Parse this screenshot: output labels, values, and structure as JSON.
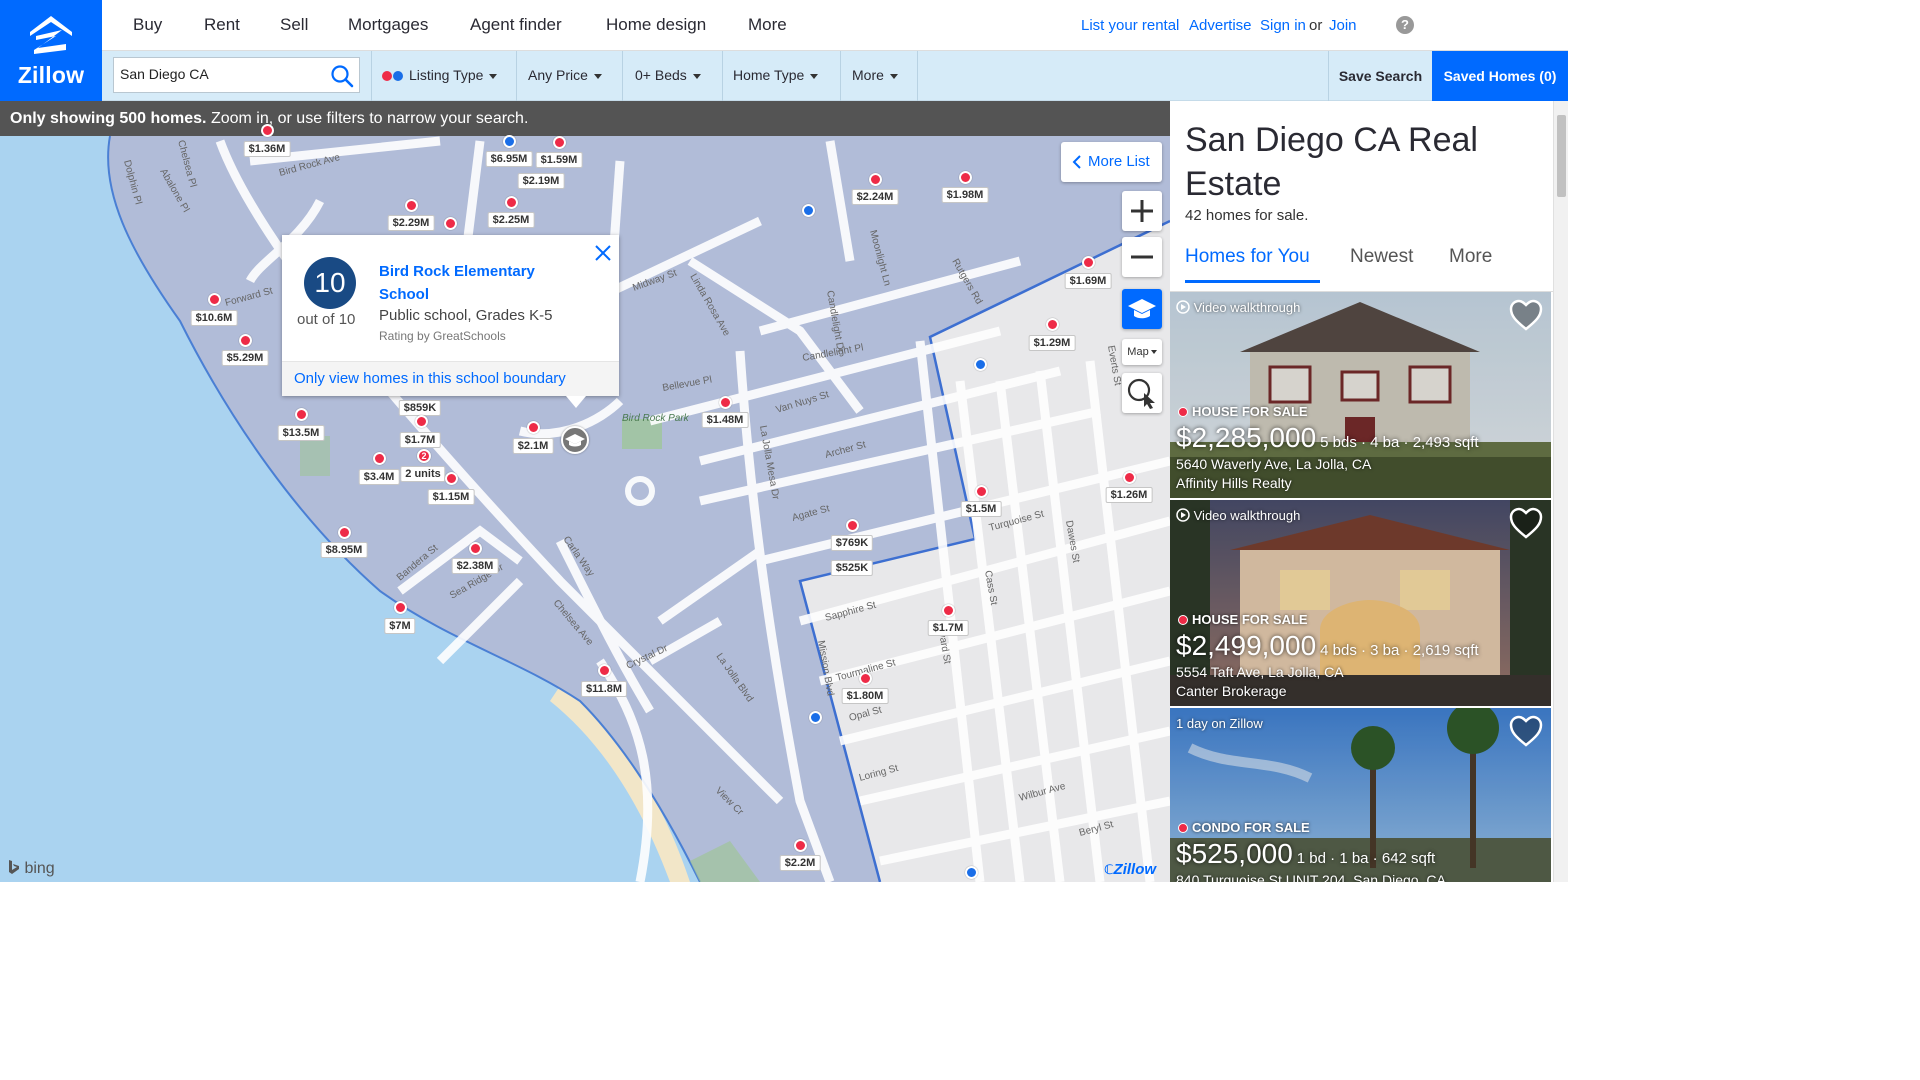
{
  "brand": {
    "name": "Zillow",
    "color": "#006aff"
  },
  "nav": {
    "items": [
      "Buy",
      "Rent",
      "Sell",
      "Mortgages",
      "Agent finder",
      "Home design",
      "More"
    ],
    "right": {
      "list_rental": "List your rental",
      "advertise": "Advertise",
      "sign_in": "Sign in",
      "or": "or",
      "join": "Join",
      "help": "?"
    }
  },
  "filters": {
    "search_value": "San Diego CA",
    "listing_type": "Listing Type",
    "price": "Any Price",
    "beds": "0+ Beds",
    "home_type": "Home Type",
    "more": "More",
    "save_search": "Save Search",
    "saved_homes": "Saved Homes (0)"
  },
  "map": {
    "notice_bold": "Only showing 500 homes.",
    "notice_rest": " Zoom in, or use filters to narrow your search.",
    "more_list": "More List",
    "map_mode": "Map",
    "attribution": "bing",
    "watermark": "Zillow",
    "boundary_label": "Bird Rock Park",
    "school_popup": {
      "rating": "10",
      "out_of": "out of 10",
      "name": "Bird Rock Elementary School",
      "type": "Public school, Grades K-5",
      "source": "Rating by GreatSchools",
      "boundary_link": "Only view homes in this school boundary"
    },
    "street_labels": [
      "Bird Rock Ave",
      "Chelsea Pl",
      "Dolphin Pl",
      "Abalone Pl",
      "Forward St",
      "Midway St",
      "Linda Rosa Ave",
      "Candlelight Dr",
      "Candlelight Pl",
      "Moonlight Ln",
      "Rutgers Rd",
      "Van Nuys St",
      "Bellevue Pl",
      "Archer St",
      "Agate St",
      "La Jolla Mesa Dr",
      "Carla Way",
      "Bandera St",
      "Sea Ridge Dr",
      "Chelsea Ave",
      "Crystal Dr",
      "La Jolla Blvd",
      "Mission Blvd",
      "Turquoise St",
      "Sapphire St",
      "Tourmaline St",
      "Opal St",
      "Loring St",
      "Wilbur Ave",
      "Beryl St",
      "Cass St",
      "Dawes St",
      "Everts St",
      "Bayard St",
      "View Cr"
    ],
    "pins": [
      {
        "label": "$1.36M",
        "color": "red"
      },
      {
        "label": "$6.95M",
        "color": "blue"
      },
      {
        "label": "$1.59M",
        "color": "red"
      },
      {
        "label": "$2.19M",
        "color": "red"
      },
      {
        "label": "$2.29M",
        "color": "red"
      },
      {
        "label": "$2.25M",
        "color": "red"
      },
      {
        "label": "$2.24M",
        "color": "red"
      },
      {
        "label": "$1.98M",
        "color": "red"
      },
      {
        "label": "$1.69M",
        "color": "red"
      },
      {
        "label": "$10.6M",
        "color": "red"
      },
      {
        "label": "$5.29M",
        "color": "red"
      },
      {
        "label": "$1.29M",
        "color": "red"
      },
      {
        "label": "$859K",
        "color": "red"
      },
      {
        "label": "$1.7M",
        "color": "red"
      },
      {
        "label": "$1.48M",
        "color": "red"
      },
      {
        "label": "$13.5M",
        "color": "red"
      },
      {
        "label": "$2.1M",
        "color": "red"
      },
      {
        "label": "$3.4M",
        "color": "red"
      },
      {
        "label": "2 units",
        "color": "red"
      },
      {
        "label": "$1.15M",
        "color": "red"
      },
      {
        "label": "$1.5M",
        "color": "red"
      },
      {
        "label": "$1.26M",
        "color": "red"
      },
      {
        "label": "$8.95M",
        "color": "red"
      },
      {
        "label": "$2.38M",
        "color": "red"
      },
      {
        "label": "$769K",
        "color": "red"
      },
      {
        "label": "$525K",
        "color": "red"
      },
      {
        "label": "$7M",
        "color": "red"
      },
      {
        "label": "$1.7M",
        "color": "red"
      },
      {
        "label": "$11.8M",
        "color": "red"
      },
      {
        "label": "$1.80M",
        "color": "red"
      },
      {
        "label": "$2.2M",
        "color": "red"
      }
    ],
    "cluster_count": "2"
  },
  "sidebar": {
    "title": "San Diego CA Real Estate",
    "count": "42 homes for sale.",
    "tabs": [
      "Homes for You",
      "Newest",
      "More"
    ],
    "listings": [
      {
        "top": "Video walkthrough",
        "type": "HOUSE FOR SALE",
        "price": "$2,285,000",
        "facts": "5 bds · 4 ba · 2,493 sqft",
        "address": "5640 Waverly Ave, La Jolla, CA",
        "broker": "Affinity Hills Realty"
      },
      {
        "top": "Video walkthrough",
        "type": "HOUSE FOR SALE",
        "price": "$2,499,000",
        "facts": "4 bds · 3 ba · 2,619 sqft",
        "address": "5554 Taft Ave, La Jolla, CA",
        "broker": "Canter Brokerage"
      },
      {
        "top": "1 day on Zillow",
        "type": "CONDO FOR SALE",
        "price": "$525,000",
        "facts": "1 bd · 1 ba · 642 sqft",
        "address": "840 Turquoise St UNIT 204, San Diego, CA",
        "broker": ""
      }
    ]
  }
}
